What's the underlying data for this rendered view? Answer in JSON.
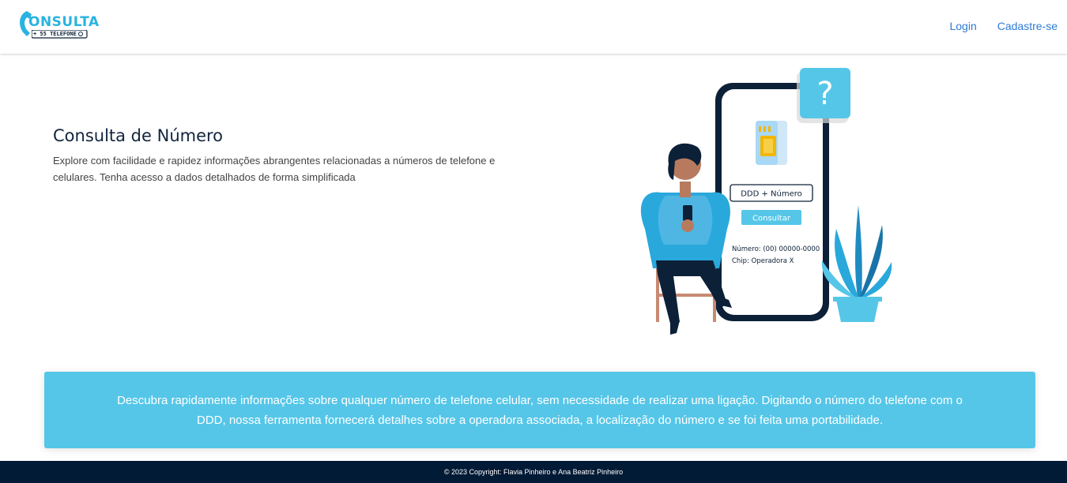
{
  "brand": {
    "logo_main": "ONSULTA",
    "logo_sub": "+ 55 TELEFONE"
  },
  "nav": {
    "login_label": "Login",
    "signup_label": "Cadastre-se"
  },
  "hero": {
    "title": "Consulta de Número",
    "description": "Explore com facilidade e rapidez informações abrangentes relacionadas a números de telefone e celulares. Tenha acesso a dados detalhados de forma simplificada"
  },
  "illustration": {
    "input_label": "DDD + Número",
    "button_label": "Consultar",
    "result_number": "Número: (00) 00000-0000",
    "result_chip": "Chip: Operadora X",
    "question_mark": "?"
  },
  "info": {
    "text": "Descubra rapidamente informações sobre qualquer número de telefone celular, sem necessidade de realizar uma ligação. Digitando o número do telefone com o DDD, nossa ferramenta fornecerá detalhes sobre a operadora associada, a localização do número e se foi feita uma portabilidade."
  },
  "footer": {
    "copyright": "© 2023 Copyright: Flavia Pinheiro e Ana Beatriz Pinheiro"
  },
  "colors": {
    "accent": "#55c6e8",
    "navy": "#011a35",
    "link": "#2e7bd6"
  }
}
